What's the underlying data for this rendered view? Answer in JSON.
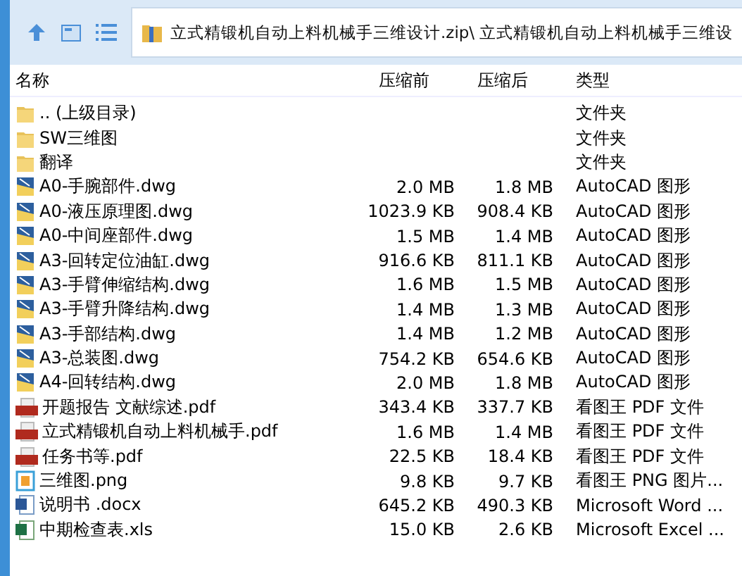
{
  "address_bar": {
    "path": "立式精锻机自动上料机械手三维设计.zip\\ 立式精锻机自动上料机械手三维设"
  },
  "table": {
    "columns": [
      "名称",
      "压缩前",
      "压缩后",
      "类型"
    ],
    "rows": [
      {
        "kind": "folder",
        "name": ".. (上级目录)",
        "type": "文件夹"
      },
      {
        "kind": "folder",
        "name": "SW三维图",
        "type": "文件夹"
      },
      {
        "kind": "folder",
        "name": "翻译",
        "type": "文件夹"
      },
      {
        "kind": "dwg",
        "name": "A0-手腕部件.dwg",
        "size": "2.0 MB",
        "packed": "1.8 MB",
        "type": "AutoCAD 图形"
      },
      {
        "kind": "dwg",
        "name": "A0-液压原理图.dwg",
        "size": "1023.9 KB",
        "packed": "908.4 KB",
        "type": "AutoCAD 图形"
      },
      {
        "kind": "dwg",
        "name": "A0-中间座部件.dwg",
        "size": "1.5 MB",
        "packed": "1.4 MB",
        "type": "AutoCAD 图形"
      },
      {
        "kind": "dwg",
        "name": "A3-回转定位油缸.dwg",
        "size": "916.6 KB",
        "packed": "811.1 KB",
        "type": "AutoCAD 图形"
      },
      {
        "kind": "dwg",
        "name": "A3-手臂伸缩结构.dwg",
        "size": "1.6 MB",
        "packed": "1.5 MB",
        "type": "AutoCAD 图形"
      },
      {
        "kind": "dwg",
        "name": "A3-手臂升降结构.dwg",
        "size": "1.4 MB",
        "packed": "1.3 MB",
        "type": "AutoCAD 图形"
      },
      {
        "kind": "dwg",
        "name": "A3-手部结构.dwg",
        "size": "1.4 MB",
        "packed": "1.2 MB",
        "type": "AutoCAD 图形"
      },
      {
        "kind": "dwg",
        "name": "A3-总装图.dwg",
        "size": "754.2 KB",
        "packed": "654.6 KB",
        "type": "AutoCAD 图形"
      },
      {
        "kind": "dwg",
        "name": "A4-回转结构.dwg",
        "size": "2.0 MB",
        "packed": "1.8 MB",
        "type": "AutoCAD 图形"
      },
      {
        "kind": "pdf",
        "name": "开题报告 文献综述.pdf",
        "size": "343.4 KB",
        "packed": "337.7 KB",
        "type": "看图王 PDF 文件"
      },
      {
        "kind": "pdf",
        "name": "立式精锻机自动上料机械手.pdf",
        "size": "1.6 MB",
        "packed": "1.4 MB",
        "type": "看图王 PDF 文件"
      },
      {
        "kind": "pdf",
        "name": "任务书等.pdf",
        "size": "22.5 KB",
        "packed": "18.4 KB",
        "type": "看图王 PDF 文件"
      },
      {
        "kind": "png",
        "name": "三维图.png",
        "size": "9.8 KB",
        "packed": "9.7 KB",
        "type": "看图王 PNG 图片..."
      },
      {
        "kind": "docx",
        "name": "说明书 .docx",
        "size": "645.2 KB",
        "packed": "490.3 KB",
        "type": "Microsoft Word ..."
      },
      {
        "kind": "xls",
        "name": "中期检查表.xls",
        "size": "15.0 KB",
        "packed": "2.6 KB",
        "type": "Microsoft Excel ..."
      }
    ]
  }
}
